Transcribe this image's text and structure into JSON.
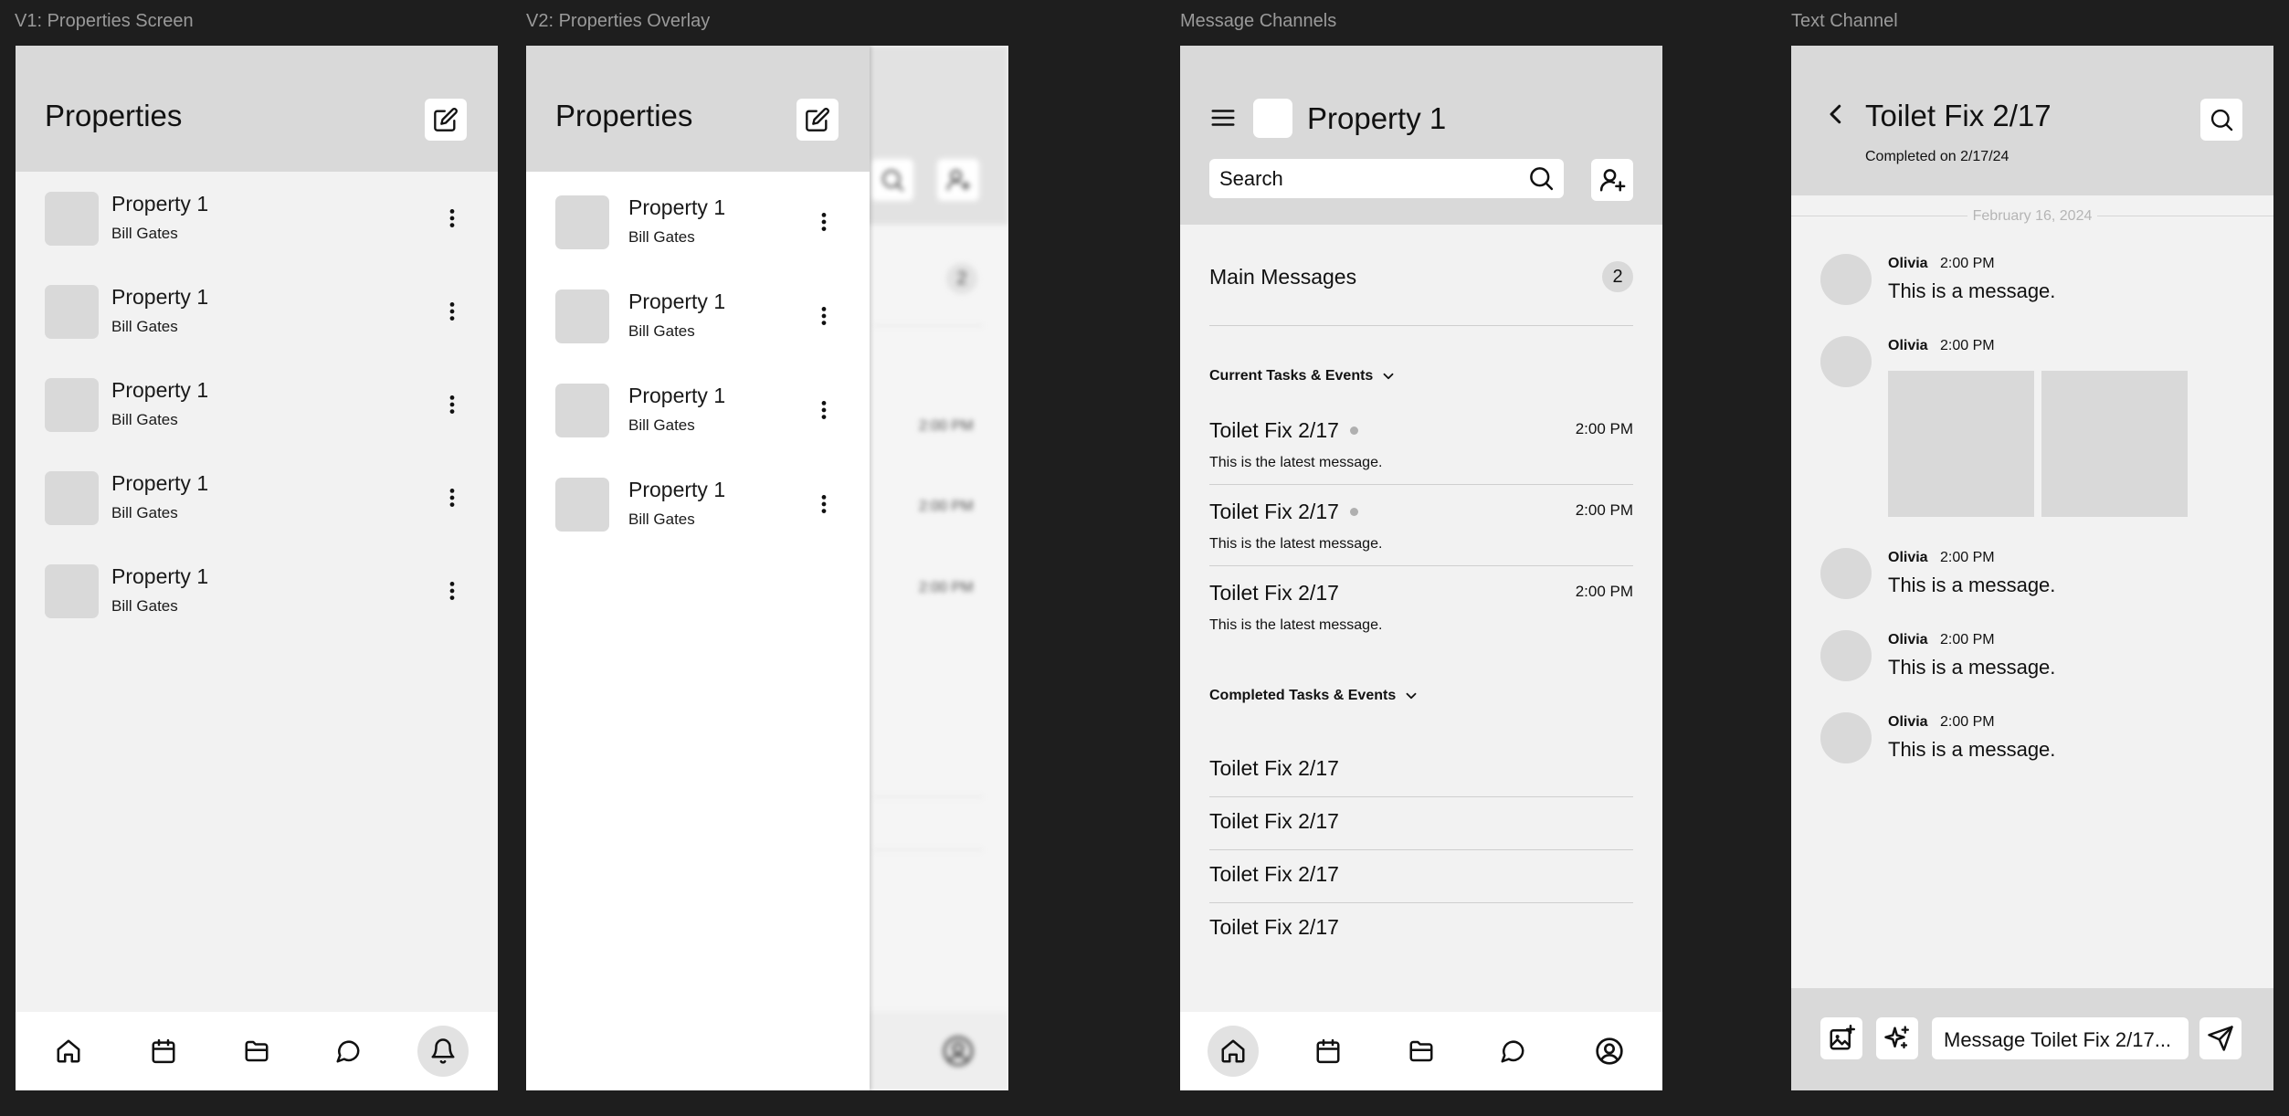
{
  "frames": {
    "v1": "V1: Properties Screen",
    "v2": "V2: Properties Overlay",
    "channels": "Message Channels",
    "text": "Text Channel"
  },
  "v1": {
    "title": "Properties",
    "items": [
      {
        "name": "Property 1",
        "owner": "Bill Gates"
      },
      {
        "name": "Property 1",
        "owner": "Bill Gates"
      },
      {
        "name": "Property 1",
        "owner": "Bill Gates"
      },
      {
        "name": "Property 1",
        "owner": "Bill Gates"
      },
      {
        "name": "Property 1",
        "owner": "Bill Gates"
      }
    ]
  },
  "v2": {
    "title": "Properties",
    "items": [
      {
        "name": "Property 1",
        "owner": "Bill Gates"
      },
      {
        "name": "Property 1",
        "owner": "Bill Gates"
      },
      {
        "name": "Property 1",
        "owner": "Bill Gates"
      },
      {
        "name": "Property 1",
        "owner": "Bill Gates"
      }
    ],
    "behind_badge": "2",
    "behind_times": [
      "2:00 PM",
      "2:00 PM",
      "2:00 PM"
    ]
  },
  "channels": {
    "property_name": "Property 1",
    "search_placeholder": "Search",
    "main_messages": "Main Messages",
    "main_count": "2",
    "current_header": "Current Tasks & Events",
    "current": [
      {
        "title": "Toilet Fix 2/17",
        "time": "2:00 PM",
        "preview": "This is the latest message.",
        "unread": true
      },
      {
        "title": "Toilet Fix 2/17",
        "time": "2:00 PM",
        "preview": "This is the latest message.",
        "unread": true
      },
      {
        "title": "Toilet Fix 2/17",
        "time": "2:00 PM",
        "preview": "This is the latest message.",
        "unread": false
      }
    ],
    "completed_header": "Completed Tasks & Events",
    "completed": [
      "Toilet Fix 2/17",
      "Toilet Fix 2/17",
      "Toilet Fix 2/17",
      "Toilet Fix 2/17"
    ]
  },
  "text_channel": {
    "title": "Toilet Fix 2/17",
    "subtitle": "Completed on 2/17/24",
    "date_divider": "February 16, 2024",
    "messages": [
      {
        "name": "Olivia",
        "time": "2:00 PM",
        "text": "This is a message."
      },
      {
        "name": "Olivia",
        "time": "2:00 PM",
        "text": ""
      },
      {
        "name": "Olivia",
        "time": "2:00 PM",
        "text": "This is a message."
      },
      {
        "name": "Olivia",
        "time": "2:00 PM",
        "text": "This is a message."
      },
      {
        "name": "Olivia",
        "time": "2:00 PM",
        "text": "This is a message."
      }
    ],
    "input_placeholder": "Message Toilet Fix 2/17..."
  },
  "colors": {
    "canvas": "#1e1e1e",
    "screen_bg": "#f2f2f2",
    "header_bg": "#d9d9d9",
    "placeholder": "#d9d9d9",
    "active_nav": "#e2e2e2"
  },
  "icons": {
    "edit": "edit-icon",
    "more": "more-vertical-icon",
    "home": "home-icon",
    "calendar": "calendar-icon",
    "folder": "folder-icon",
    "chat": "chat-icon",
    "bell": "bell-icon",
    "profile": "profile-icon",
    "menu": "menu-icon",
    "search": "search-icon",
    "add_user": "add-user-icon",
    "chevron_down": "chevron-down-icon",
    "back": "back-icon",
    "image": "image-icon",
    "sparkle": "sparkle-icon",
    "send": "send-icon"
  }
}
